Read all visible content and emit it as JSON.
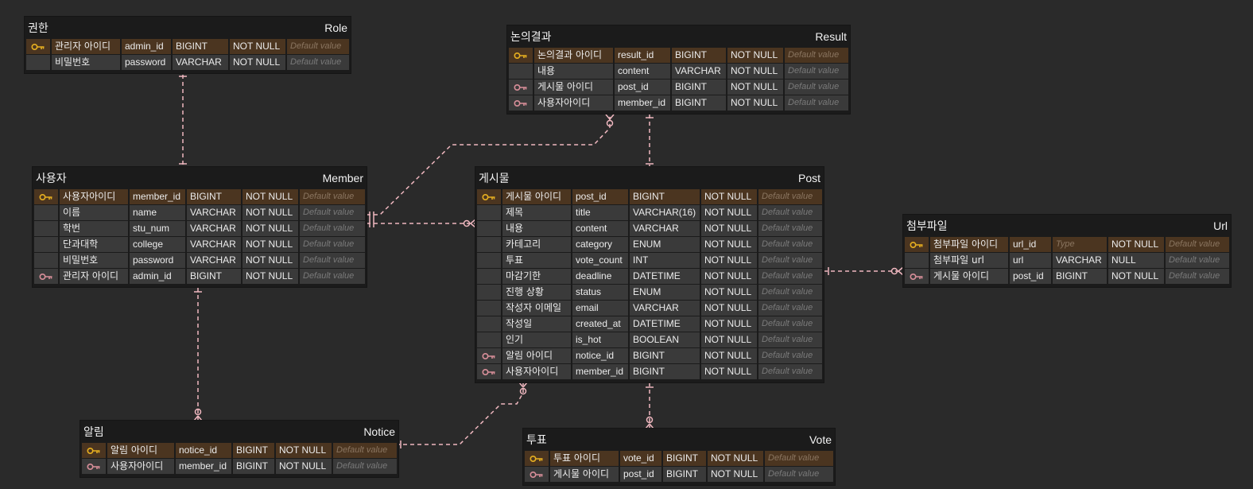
{
  "colors": {
    "background": "#2a2a2a",
    "table": "#1b1b1b",
    "cell": "#3a3a3a",
    "pk_row": "#4b3520",
    "pk_icon": "#e8b020",
    "fk_icon": "#d98f9a",
    "link": "#f0b8c0"
  },
  "default_placeholder": "Default value",
  "type_placeholder": "Type",
  "tables": [
    {
      "id": "role",
      "title_ko": "권한",
      "title_en": "Role",
      "rows": [
        {
          "key": "pk",
          "name_ko": "관리자 아이디",
          "column": "admin_id",
          "type": "BIGINT",
          "nullable": "NOT NULL"
        },
        {
          "key": "",
          "name_ko": "비밀번호",
          "column": "password",
          "type": "VARCHAR",
          "nullable": "NOT NULL"
        }
      ]
    },
    {
      "id": "result",
      "title_ko": "논의결과",
      "title_en": "Result",
      "rows": [
        {
          "key": "pk",
          "name_ko": "논의결과 아이디",
          "column": "result_id",
          "type": "BIGINT",
          "nullable": "NOT NULL"
        },
        {
          "key": "",
          "name_ko": "내용",
          "column": "content",
          "type": "VARCHAR",
          "nullable": "NOT NULL"
        },
        {
          "key": "fk",
          "name_ko": "게시물 아이디",
          "column": "post_id",
          "type": "BIGINT",
          "nullable": "NOT NULL"
        },
        {
          "key": "fk",
          "name_ko": "사용자아이디",
          "column": "member_id",
          "type": "BIGINT",
          "nullable": "NOT NULL"
        }
      ]
    },
    {
      "id": "member",
      "title_ko": "사용자",
      "title_en": "Member",
      "rows": [
        {
          "key": "pk",
          "name_ko": "사용자아이디",
          "column": "member_id",
          "type": "BIGINT",
          "nullable": "NOT NULL"
        },
        {
          "key": "",
          "name_ko": "이름",
          "column": "name",
          "type": "VARCHAR",
          "nullable": "NOT NULL"
        },
        {
          "key": "",
          "name_ko": "학번",
          "column": "stu_num",
          "type": "VARCHAR",
          "nullable": "NOT NULL"
        },
        {
          "key": "",
          "name_ko": "단과대학",
          "column": "college",
          "type": "VARCHAR",
          "nullable": "NOT NULL"
        },
        {
          "key": "",
          "name_ko": "비밀번호",
          "column": "password",
          "type": "VARCHAR",
          "nullable": "NOT NULL"
        },
        {
          "key": "fk",
          "name_ko": "관리자 아이디",
          "column": "admin_id",
          "type": "BIGINT",
          "nullable": "NOT NULL"
        }
      ]
    },
    {
      "id": "post",
      "title_ko": "게시물",
      "title_en": "Post",
      "rows": [
        {
          "key": "pk",
          "name_ko": "게시물 아이디",
          "column": "post_id",
          "type": "BIGINT",
          "nullable": "NOT NULL"
        },
        {
          "key": "",
          "name_ko": "제목",
          "column": "title",
          "type": "VARCHAR(16)",
          "nullable": "NOT NULL"
        },
        {
          "key": "",
          "name_ko": "내용",
          "column": "content",
          "type": "VARCHAR",
          "nullable": "NOT NULL"
        },
        {
          "key": "",
          "name_ko": "카테고리",
          "column": "category",
          "type": "ENUM",
          "nullable": "NOT NULL"
        },
        {
          "key": "",
          "name_ko": "투표",
          "column": "vote_count",
          "type": "INT",
          "nullable": "NOT NULL"
        },
        {
          "key": "",
          "name_ko": "마감기한",
          "column": "deadline",
          "type": "DATETIME",
          "nullable": "NOT NULL"
        },
        {
          "key": "",
          "name_ko": "진행 상황",
          "column": "status",
          "type": "ENUM",
          "nullable": "NOT NULL"
        },
        {
          "key": "",
          "name_ko": "작성자 이메일",
          "column": "email",
          "type": "VARCHAR",
          "nullable": "NOT NULL"
        },
        {
          "key": "",
          "name_ko": "작성일",
          "column": "created_at",
          "type": "DATETIME",
          "nullable": "NOT NULL"
        },
        {
          "key": "",
          "name_ko": "인기",
          "column": "is_hot",
          "type": "BOOLEAN",
          "nullable": "NOT NULL"
        },
        {
          "key": "fk",
          "name_ko": "알림 아이디",
          "column": "notice_id",
          "type": "BIGINT",
          "nullable": "NOT NULL"
        },
        {
          "key": "fk",
          "name_ko": "사용자아이디",
          "column": "member_id",
          "type": "BIGINT",
          "nullable": "NOT NULL"
        }
      ]
    },
    {
      "id": "url",
      "title_ko": "첨부파일",
      "title_en": "Url",
      "rows": [
        {
          "key": "pk",
          "name_ko": "첨부파일 아이디",
          "column": "url_id",
          "type": "",
          "nullable": "NOT NULL"
        },
        {
          "key": "",
          "name_ko": "첨부파일 url",
          "column": "url",
          "type": "VARCHAR",
          "nullable": "NULL"
        },
        {
          "key": "fk",
          "name_ko": "게시물 아이디",
          "column": "post_id",
          "type": "BIGINT",
          "nullable": "NOT NULL"
        }
      ]
    },
    {
      "id": "notice",
      "title_ko": "알림",
      "title_en": "Notice",
      "rows": [
        {
          "key": "pk",
          "name_ko": "알림 아이디",
          "column": "notice_id",
          "type": "BIGINT",
          "nullable": "NOT NULL"
        },
        {
          "key": "fk",
          "name_ko": "사용자아이디",
          "column": "member_id",
          "type": "BIGINT",
          "nullable": "NOT NULL"
        }
      ]
    },
    {
      "id": "vote",
      "title_ko": "투표",
      "title_en": "Vote",
      "rows": [
        {
          "key": "pk",
          "name_ko": "투표 아이디",
          "column": "vote_id",
          "type": "BIGINT",
          "nullable": "NOT NULL"
        },
        {
          "key": "fk",
          "name_ko": "게시물 아이디",
          "column": "post_id",
          "type": "BIGINT",
          "nullable": "NOT NULL"
        }
      ]
    }
  ],
  "relationships": [
    {
      "from": "role",
      "to": "member",
      "type": "one-to-one"
    },
    {
      "from": "member",
      "to": "result",
      "type": "one-to-zero-or-many"
    },
    {
      "from": "member",
      "to": "post",
      "type": "one-to-zero-or-many"
    },
    {
      "from": "member",
      "to": "notice",
      "type": "one-to-zero-or-one"
    },
    {
      "from": "result",
      "to": "post",
      "type": "one-to-one"
    },
    {
      "from": "post",
      "to": "url",
      "type": "one-to-zero-or-many"
    },
    {
      "from": "notice",
      "to": "post",
      "type": "one-to-zero-or-many"
    },
    {
      "from": "post",
      "to": "vote",
      "type": "one-to-zero-or-many"
    }
  ]
}
